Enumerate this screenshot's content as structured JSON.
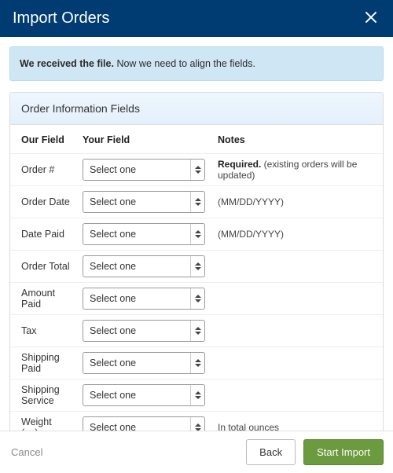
{
  "header": {
    "title": "Import Orders"
  },
  "banner": {
    "strong": "We received the file.",
    "rest": " Now we need to align the fields."
  },
  "panel": {
    "title": "Order Information Fields",
    "columns": {
      "our_field": "Our Field",
      "your_field": "Your Field",
      "notes": "Notes"
    },
    "select_placeholder": "Select one",
    "rows": [
      {
        "label": "Order #",
        "notes_required": "Required.",
        "notes_rest": "  (existing orders will be updated)"
      },
      {
        "label": "Order Date",
        "notes_rest": "(MM/DD/YYYY)"
      },
      {
        "label": "Date Paid",
        "notes_rest": "(MM/DD/YYYY)"
      },
      {
        "label": "Order Total"
      },
      {
        "label": "Amount Paid"
      },
      {
        "label": "Tax"
      },
      {
        "label": "Shipping Paid"
      },
      {
        "label": "Shipping Service"
      },
      {
        "label": "Weight (oz)",
        "notes_rest": "In total ounces"
      }
    ]
  },
  "footer": {
    "cancel": "Cancel",
    "back": "Back",
    "start": "Start Import"
  }
}
